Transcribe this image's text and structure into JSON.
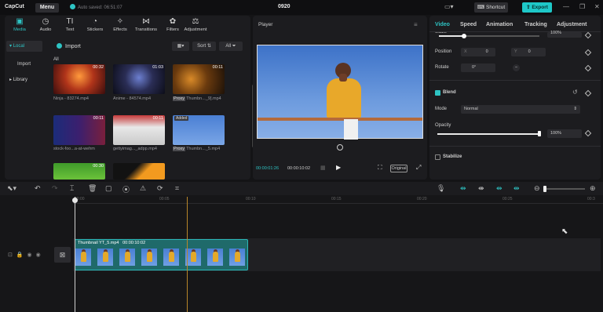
{
  "titlebar": {
    "app_name": "CapCut",
    "menu_label": "Menu",
    "autosave_text": "Auto saved: 06:51:07",
    "project_title": "0920",
    "shortcut_label": "Shortcut",
    "export_label": "Export"
  },
  "tools": [
    {
      "label": "Media",
      "icon": "media-icon"
    },
    {
      "label": "Audio",
      "icon": "audio-icon"
    },
    {
      "label": "Text",
      "icon": "text-icon"
    },
    {
      "label": "Stickers",
      "icon": "stickers-icon"
    },
    {
      "label": "Effects",
      "icon": "effects-icon"
    },
    {
      "label": "Transitions",
      "icon": "transitions-icon"
    },
    {
      "label": "Filters",
      "icon": "filters-icon"
    },
    {
      "label": "Adjustment",
      "icon": "adjustment-icon"
    }
  ],
  "sidebar": {
    "local": "Local",
    "import": "Import",
    "library": "Library"
  },
  "media": {
    "import_label": "Import",
    "sort_label": "Sort",
    "filter_label": "All",
    "section_label": "All",
    "items": [
      {
        "name": "Ninja - 83274.mp4",
        "duration": "00:32",
        "tag": ""
      },
      {
        "name": "Anime - 84574.mp4",
        "duration": "01:03",
        "tag": ""
      },
      {
        "name": "Thumbn..._9].mp4",
        "duration": "00:11",
        "tag": "Proxy"
      },
      {
        "name": "stock-foo...a-at-wehm",
        "duration": "00:11",
        "tag": ""
      },
      {
        "name": "gettyimag..._adpp.mp4",
        "duration": "00:11",
        "tag": ""
      },
      {
        "name": "Thumbn..._5.mp4",
        "duration": "",
        "tag": "Proxy",
        "badge": "Added"
      },
      {
        "name": "",
        "duration": "00:30",
        "tag": ""
      },
      {
        "name": "",
        "duration": "",
        "tag": ""
      }
    ]
  },
  "player": {
    "title": "Player",
    "current_time": "00:00:01:26",
    "total_time": "00:00:10:02",
    "original_label": "Original"
  },
  "props": {
    "tabs": [
      "Video",
      "Speed",
      "Animation",
      "Tracking",
      "Adjustment"
    ],
    "scale_label": "Scale",
    "scale_value": "100%",
    "scale_fraction": 0.25,
    "position_label": "Position",
    "x_label": "X",
    "x_value": "0",
    "y_label": "Y",
    "y_value": "0",
    "rotate_label": "Rotate",
    "rotate_value": "0°",
    "blend_label": "Blend",
    "mode_label": "Mode",
    "mode_value": "Normal",
    "opacity_label": "Opacity",
    "opacity_value": "100%",
    "opacity_fraction": 1.0,
    "stabilize_label": "Stabilize"
  },
  "timeline": {
    "ruler": [
      "00:00",
      "00:05",
      "00:10",
      "00:15",
      "00:20",
      "00:25",
      "00:3"
    ],
    "clip_name": "Thumbnail YT_5.mp4",
    "clip_duration": "00:00:10:02"
  }
}
